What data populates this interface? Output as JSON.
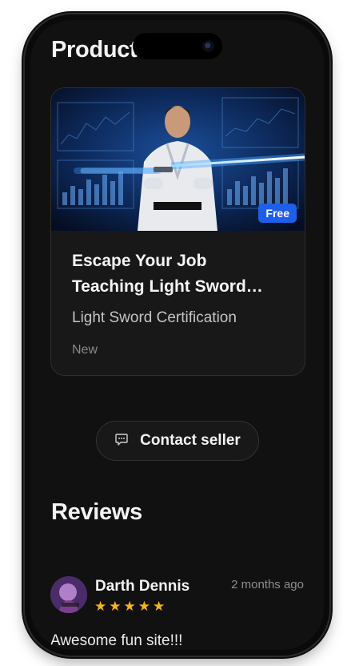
{
  "section_products_title": "Product",
  "product": {
    "badge": "Free",
    "title_line1": "Escape Your Job",
    "title_line2": "Teaching Light Sword…",
    "subtitle": "Light Sword Certification",
    "condition": "New"
  },
  "contact_button": {
    "label": "Contact seller"
  },
  "reviews_title": "Reviews",
  "review": {
    "name": "Darth Dennis",
    "time": "2 months ago",
    "rating": 5,
    "text": "Awesome fun site!!!"
  },
  "colors": {
    "background": "#111111",
    "card": "#181818",
    "badge": "#1e5ee8",
    "star": "#f4b51c"
  }
}
